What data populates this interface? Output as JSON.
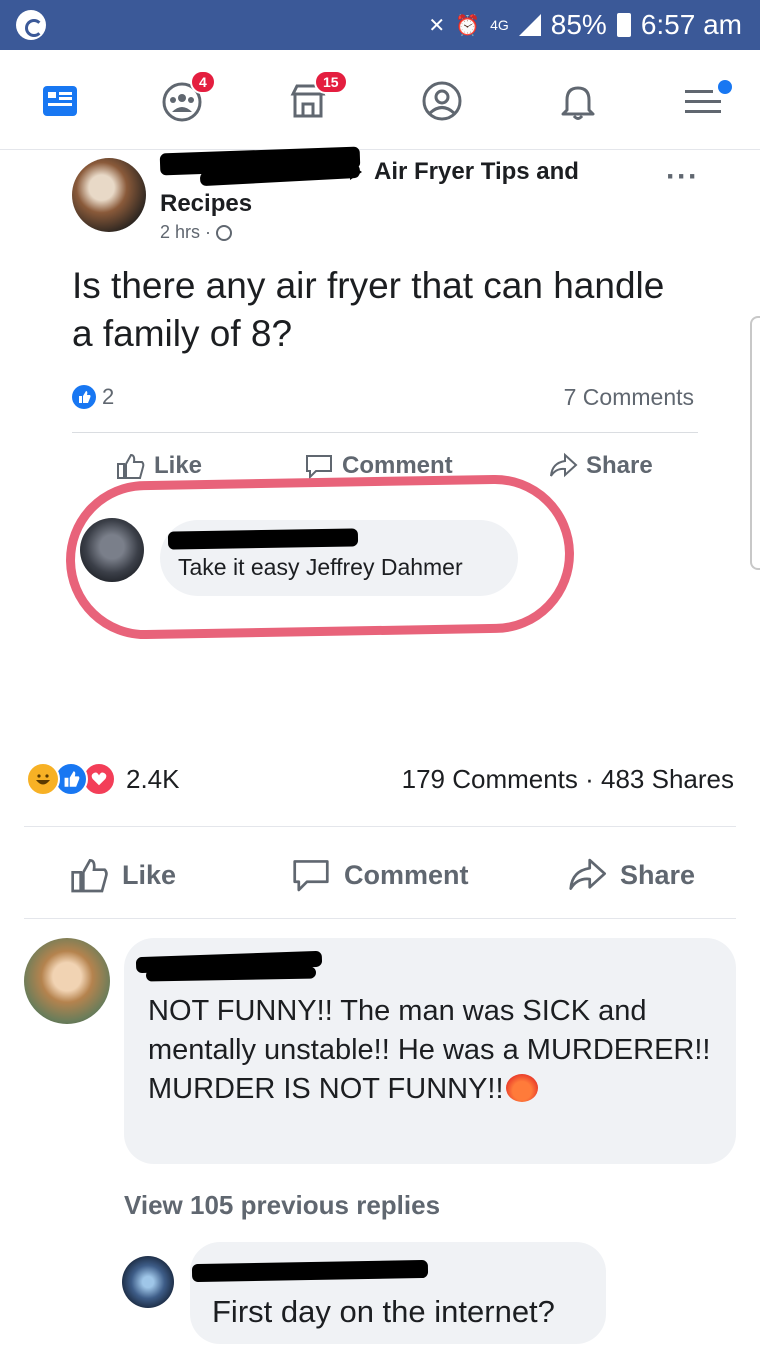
{
  "status_bar": {
    "battery": "85%",
    "time": "6:57 am",
    "network": "4G"
  },
  "nav": {
    "groups_badge": "4",
    "marketplace_badge": "15",
    "icons": [
      "news-feed-icon",
      "groups-icon",
      "marketplace-icon",
      "profile-icon",
      "notifications-icon",
      "menu-icon"
    ]
  },
  "shared_post": {
    "group_name_line1": "Air Fryer Tips and",
    "group_name_line2": "Recipes",
    "meta": "2 hrs · ",
    "text": "Is there any air fryer that can handle a family of 8?",
    "reaction_count": "2",
    "comments_count": "7 Comments",
    "like_label": "Like",
    "comment_label": "Comment",
    "share_label": "Share",
    "top_comment": "Take it easy Jeffrey Dahmer"
  },
  "outer_post": {
    "reaction_count": "2.4K",
    "stats": "179 Comments · 483 Shares",
    "like_label": "Like",
    "comment_label": "Comment",
    "share_label": "Share"
  },
  "comments": {
    "first_comment": "NOT FUNNY!! The man was SICK and mentally unstable!! He was a MURDERER!! MURDER IS NOT FUNNY!!",
    "view_replies": "View 105 previous replies",
    "reply": "First day on the internet?"
  },
  "colors": {
    "facebook_blue": "#3b5998",
    "highlight_ring": "#e8637a",
    "like_blue": "#1877f2",
    "love_red": "#f33e58",
    "haha_yellow": "#f7b125"
  }
}
